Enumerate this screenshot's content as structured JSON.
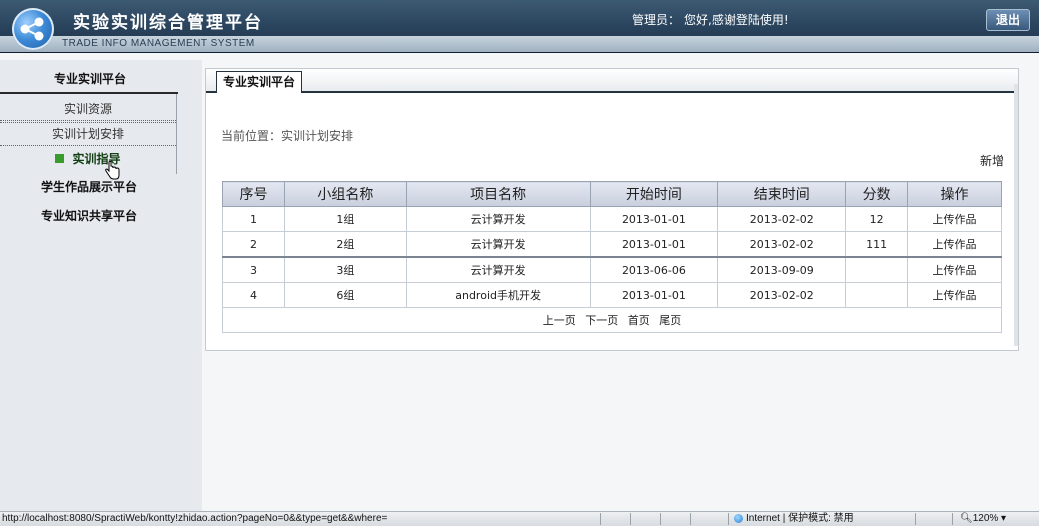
{
  "header": {
    "title": "实验实训综合管理平台",
    "subtitle": "TRADE INFO MANAGEMENT SYSTEM",
    "greeting_label": "管理员：",
    "greeting_text": "您好,感谢登陆使用!",
    "logout_label": "退出"
  },
  "sidebar": {
    "title": "专业实训平台",
    "items": [
      {
        "label": "实训资源"
      },
      {
        "label": "实训计划安排"
      },
      {
        "label": "实训指导"
      }
    ],
    "sections": [
      {
        "label": "学生作品展示平台"
      },
      {
        "label": "专业知识共享平台"
      }
    ]
  },
  "main": {
    "tab": "专业实训平台",
    "breadcrumb": "当前位置：实训计划安排",
    "add_label": "新增",
    "table": {
      "headers": [
        "序号",
        "小组名称",
        "项目名称",
        "开始时间",
        "结束时间",
        "分数",
        "操作"
      ],
      "rows": [
        [
          "1",
          "1组",
          "云计算开发",
          "2013-01-01",
          "2013-02-02",
          "12",
          "上传作品"
        ],
        [
          "2",
          "2组",
          "云计算开发",
          "2013-01-01",
          "2013-02-02",
          "111",
          "上传作品"
        ],
        [
          "3",
          "3组",
          "云计算开发",
          "2013-06-06",
          "2013-09-09",
          "",
          "上传作品"
        ],
        [
          "4",
          "6组",
          "android手机开发",
          "2013-01-01",
          "2013-02-02",
          "",
          "上传作品"
        ]
      ]
    },
    "pager": {
      "prev": "上一页",
      "next": "下一页",
      "first": "首页",
      "last": "尾页"
    }
  },
  "statusbar": {
    "url": "http://localhost:8080/SpractiWeb/kontty!zhidao.action?pageNo=0&&type=get&&where=",
    "zone": "Internet | 保护模式: 禁用",
    "zoom": "120%"
  },
  "colors": {
    "header_dark": "#1d3248",
    "sidebar_bg": "#e6eaee",
    "table_header": "#c9cfdd",
    "active_bullet": "#3a9b2d"
  },
  "icons": [
    "logo-icon",
    "bullet-icon",
    "hand-cursor-icon",
    "globe-icon",
    "zoom-icon"
  ]
}
